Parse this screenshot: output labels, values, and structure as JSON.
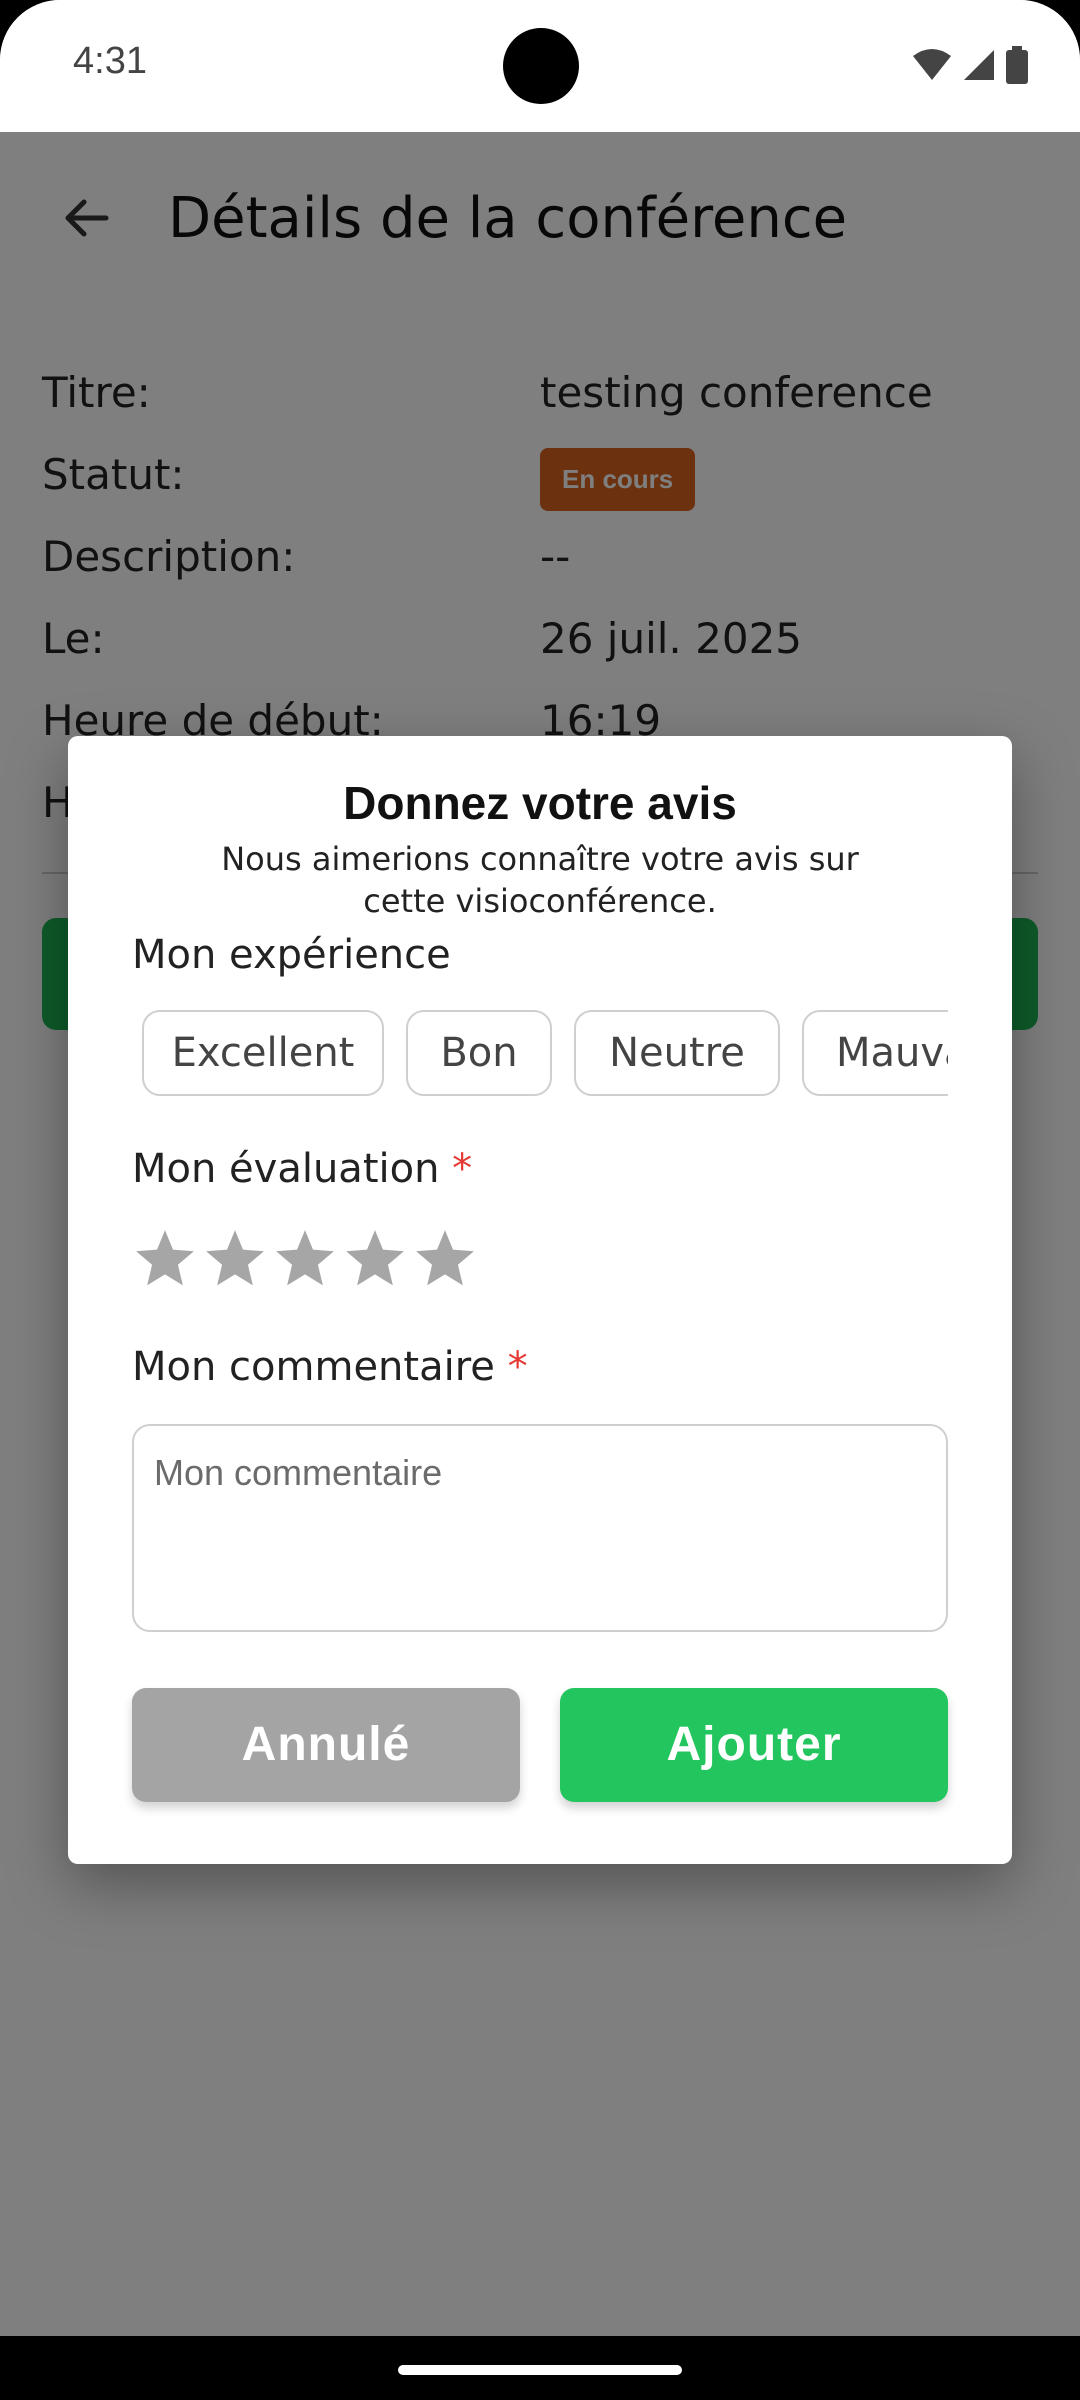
{
  "status_bar": {
    "time": "4:31"
  },
  "header": {
    "title": "Détails de la conférence"
  },
  "details": [
    {
      "label": "Titre:",
      "value": "testing conference"
    },
    {
      "label": "Statut:",
      "badge": "En cours"
    },
    {
      "label": "Description:",
      "value": "--"
    },
    {
      "label": "Le:",
      "value": "26 juil. 2025"
    },
    {
      "label": "Heure de début:",
      "value": "16:19"
    },
    {
      "label": "H"
    }
  ],
  "dialog": {
    "title": "Donnez votre avis",
    "subtitle": "Nous aimerions connaître votre avis sur cette visioconférence.",
    "experience_label": "Mon expérience",
    "experience_options": [
      "Excellent",
      "Bon",
      "Neutre",
      "Mauvais"
    ],
    "rating_label": "Mon évaluation",
    "rating_value": 0,
    "rating_max": 5,
    "required_mark": "*",
    "comment_label": "Mon commentaire",
    "comment_placeholder": "Mon commentaire",
    "cancel_label": "Annulé",
    "add_label": "Ajouter"
  },
  "colors": {
    "badge": "#d9651e",
    "primary_green": "#22c55e",
    "cancel_gray": "#a4a4a4",
    "star_gray": "#a6a6a6",
    "required_red": "#e53935"
  }
}
